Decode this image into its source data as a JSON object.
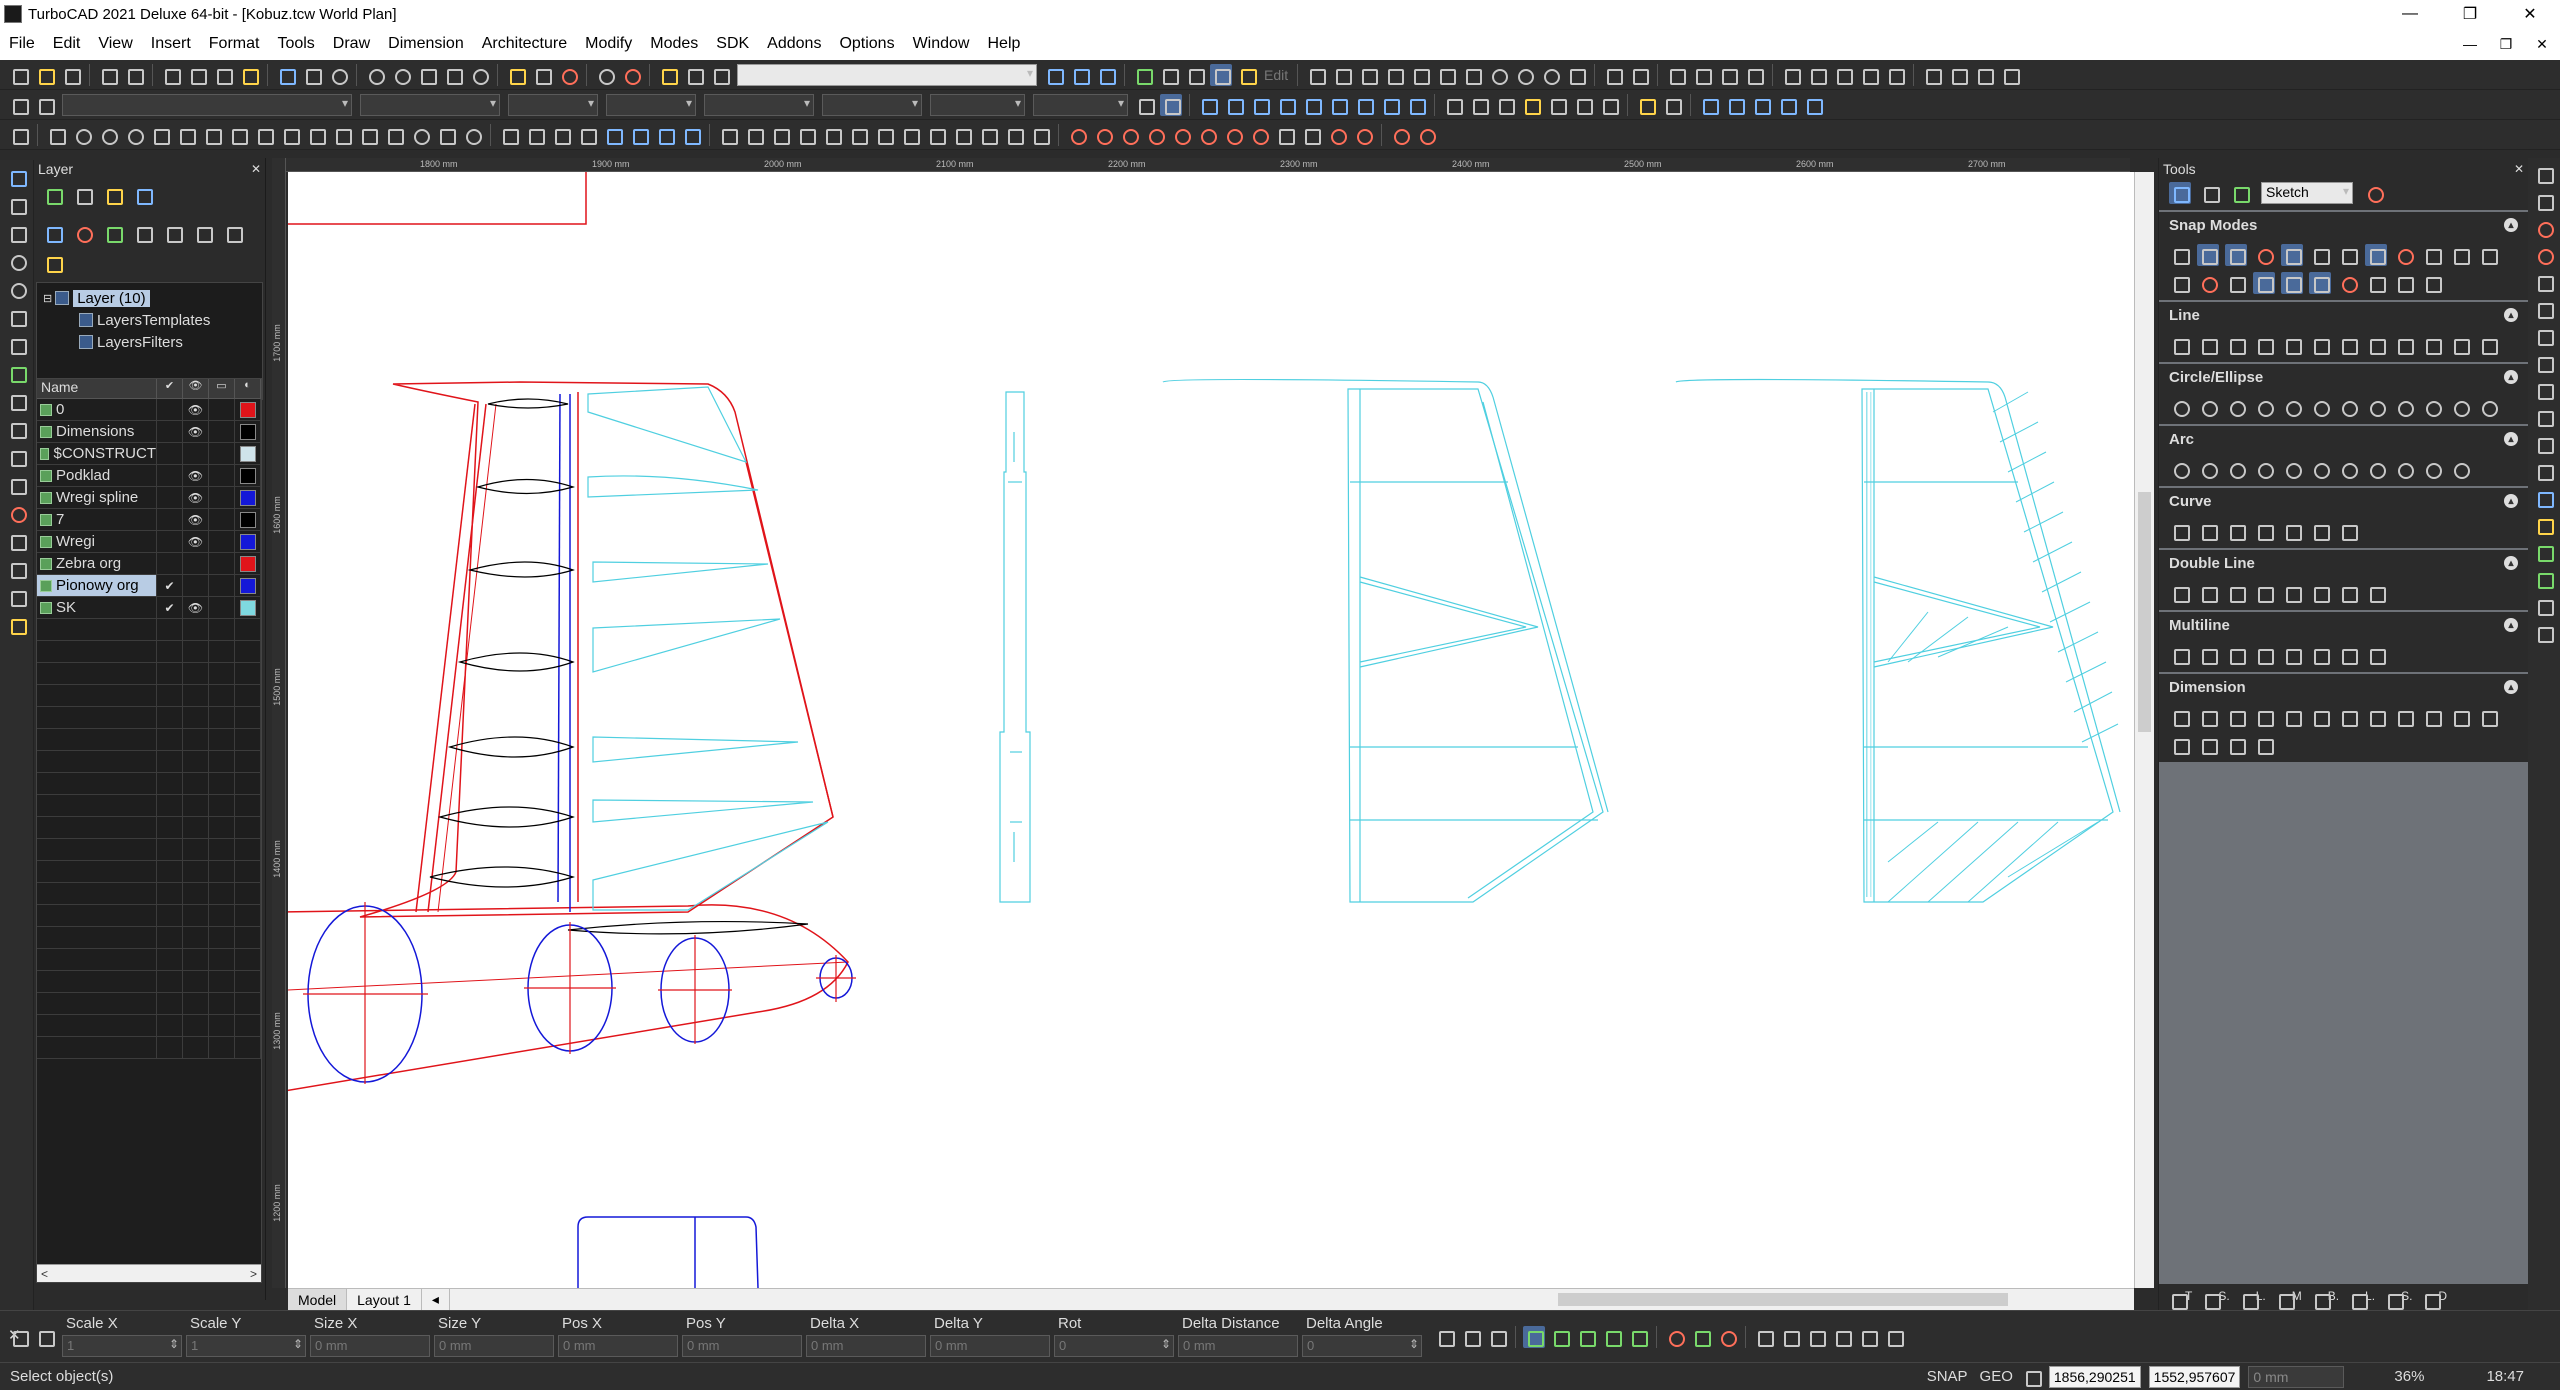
{
  "window": {
    "title": "TurboCAD 2021 Deluxe 64-bit - [Kobuz.tcw World Plan]",
    "controls": [
      "—",
      "❐",
      "✕"
    ]
  },
  "menu": {
    "items": [
      "File",
      "Edit",
      "View",
      "Insert",
      "Format",
      "Tools",
      "Draw",
      "Dimension",
      "Architecture",
      "Modify",
      "Modes",
      "SDK",
      "Addons",
      "Options",
      "Window",
      "Help"
    ],
    "doc_controls": [
      "—",
      "❐",
      "✕"
    ]
  },
  "toolbar": {
    "edit_label": "Edit"
  },
  "layer_panel": {
    "title": "Layer",
    "tree": {
      "root": "Layer (10)",
      "children": [
        "LayersTemplates",
        "LayersFilters"
      ]
    },
    "header_name": "Name",
    "rows": [
      {
        "name": "0",
        "visible": "👁",
        "color": "#e0141a",
        "check": ""
      },
      {
        "name": "Dimensions",
        "visible": "👁",
        "color": "#000000",
        "check": ""
      },
      {
        "name": "$CONSTRUCT",
        "visible": "",
        "color": "#cfe3ea",
        "check": ""
      },
      {
        "name": "Podklad",
        "visible": "👁",
        "color": "#000000",
        "check": ""
      },
      {
        "name": "Wregi spline",
        "visible": "👁",
        "color": "#1418d8",
        "check": ""
      },
      {
        "name": "7",
        "visible": "👁",
        "color": "#000000",
        "check": ""
      },
      {
        "name": "Wregi",
        "visible": "👁",
        "color": "#1418d8",
        "check": ""
      },
      {
        "name": "Zebra org",
        "visible": "",
        "color": "#e0141a",
        "check": ""
      },
      {
        "name": "Pionowy org",
        "visible": "",
        "color": "#1418d8",
        "check": "✔"
      },
      {
        "name": "SK",
        "visible": "👁",
        "color": "#7fd9e0",
        "check": "✔"
      }
    ]
  },
  "rulers": {
    "h_labels": [
      "1800 mm",
      "1900 mm",
      "2000 mm",
      "2100 mm",
      "2200 mm",
      "2300 mm",
      "2400 mm",
      "2500 mm",
      "2600 mm",
      "2700 mm"
    ],
    "v_labels": [
      "1700 mm",
      "1600 mm",
      "1500 mm",
      "1400 mm",
      "1300 mm",
      "1200 mm"
    ]
  },
  "tabs": {
    "model": "Model",
    "layout": "Layout 1"
  },
  "tools_panel": {
    "title": "Tools",
    "mode_value": "Sketch",
    "sections": [
      "Snap Modes",
      "Line",
      "Circle/Ellipse",
      "Arc",
      "Curve",
      "Double Line",
      "Multiline",
      "Dimension"
    ],
    "bottom_tabs": [
      "T",
      "S.",
      "L.",
      "M",
      "B.",
      "L.",
      "S.",
      "D"
    ]
  },
  "coord_bar": {
    "fields": [
      {
        "label": "Scale X",
        "value": "1"
      },
      {
        "label": "Scale Y",
        "value": "1"
      },
      {
        "label": "Size X",
        "value": "0 mm"
      },
      {
        "label": "Size Y",
        "value": "0 mm"
      },
      {
        "label": "Pos X",
        "value": "0 mm"
      },
      {
        "label": "Pos Y",
        "value": "0 mm"
      },
      {
        "label": "Delta X",
        "value": "0 mm"
      },
      {
        "label": "Delta Y",
        "value": "0 mm"
      },
      {
        "label": "Rot",
        "value": "0"
      },
      {
        "label": "Delta Distance",
        "value": "0 mm"
      },
      {
        "label": "Delta Angle",
        "value": "0"
      }
    ]
  },
  "status": {
    "message": "Select object(s)",
    "snap": "SNAP",
    "geo": "GEO",
    "x": "1856,290251",
    "y": "1552,957607",
    "z": "0 mm",
    "zoom": "36%",
    "time": "18:47"
  }
}
